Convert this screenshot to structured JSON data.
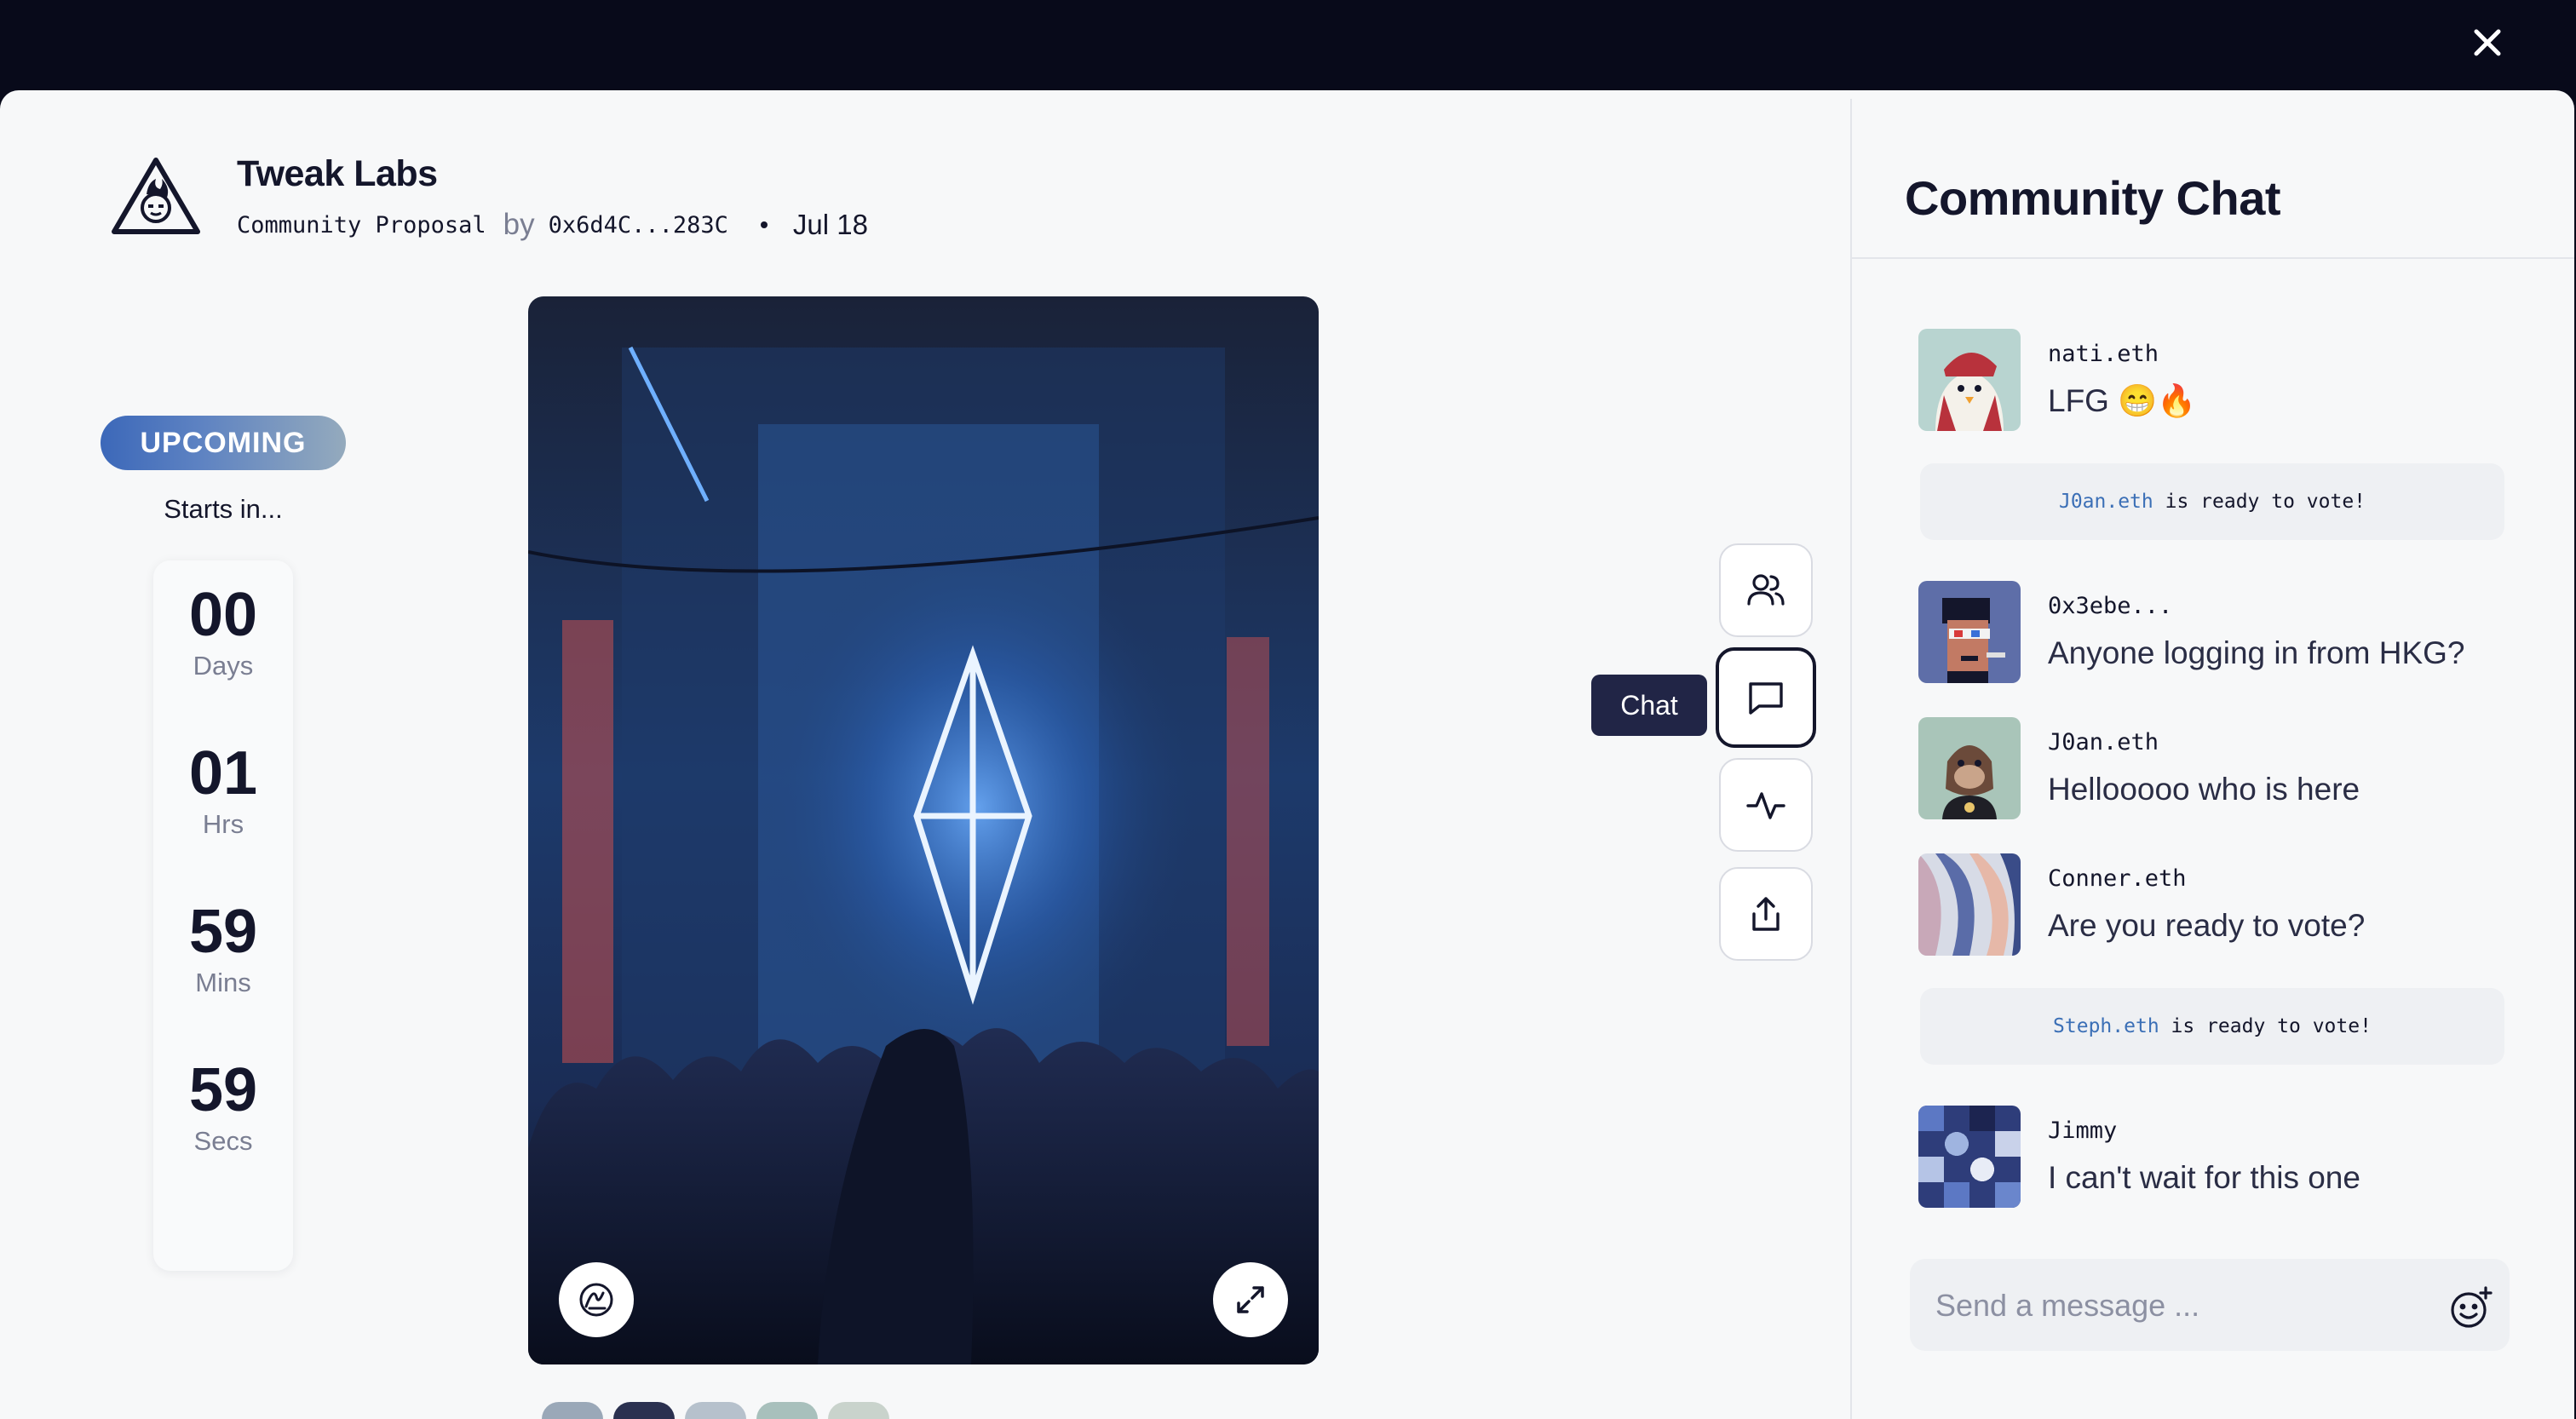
{
  "proposal": {
    "org_name": "Tweak Labs",
    "type": "Community Proposal",
    "by": "by",
    "author": "0x6d4C...283C",
    "date": "Jul 18"
  },
  "countdown": {
    "status": "UPCOMING",
    "starts_label": "Starts in...",
    "units": [
      {
        "value": "00",
        "label": "Days"
      },
      {
        "value": "01",
        "label": "Hrs"
      },
      {
        "value": "59",
        "label": "Mins"
      },
      {
        "value": "59",
        "label": "Secs"
      }
    ]
  },
  "side_actions": {
    "tooltip": "Chat",
    "icons": [
      "members-icon",
      "chat-icon",
      "activity-icon",
      "share-icon"
    ]
  },
  "chat": {
    "title": "Community Chat",
    "messages": [
      {
        "user": "nati.eth",
        "text": "LFG 😁🔥",
        "avatar": "penguin-avatar"
      },
      {
        "user": "0x3ebe...",
        "text": "Anyone logging in from HKG?",
        "avatar": "punk-avatar"
      },
      {
        "user": "J0an.eth",
        "text": "Hellooooo who is here",
        "avatar": "ape-avatar"
      },
      {
        "user": "Conner.eth",
        "text": "Are you ready to vote?",
        "avatar": "abstract-avatar"
      },
      {
        "user": "Jimmy",
        "text": "I can't wait for this one",
        "avatar": "geometric-avatar"
      }
    ],
    "system_messages": [
      {
        "user": "J0an.eth",
        "text": "is ready to vote!"
      },
      {
        "user": "Steph.eth",
        "text": "is ready to vote!"
      }
    ],
    "composer_placeholder": "Send a message ..."
  },
  "colors": {
    "backdrop": "#080a1a",
    "surface": "#f7f8f9",
    "ink": "#14162b",
    "accent_blue": "#3b6fb6",
    "tooltip_bg": "#212546"
  }
}
